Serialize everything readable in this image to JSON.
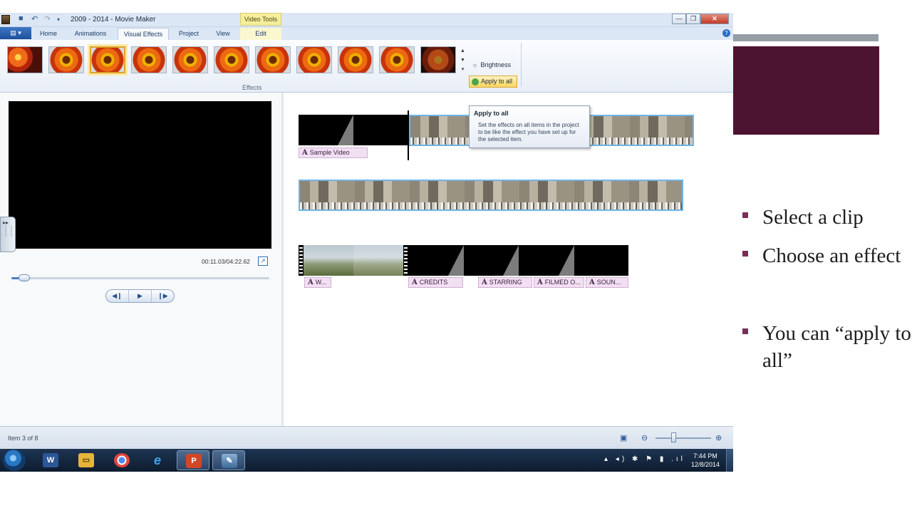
{
  "window": {
    "title": "2009 - 2014 - Movie Maker",
    "contextual_tab_group": "Video Tools",
    "buttons": [
      "—",
      "❐",
      "✕"
    ]
  },
  "tabs": [
    "Home",
    "Animations",
    "Visual Effects",
    "Project",
    "View",
    "Edit"
  ],
  "ribbon": {
    "effects_group_label": "Effects",
    "brightness_label": "Brightness",
    "apply_all_label": "Apply to all"
  },
  "tooltip": {
    "title": "Apply to all",
    "body": "Set the effects on all items in the project to be like the effect you have set up for the selected item."
  },
  "preview": {
    "timecode": "00:11.03/04:22.62",
    "seek_position": 0.05
  },
  "storyboard": {
    "captions_row1": [
      "Sample Video"
    ],
    "captions_row3": [
      "W...",
      "CREDITS",
      "STARRING",
      "FILMED O...",
      "SOUN..."
    ]
  },
  "status": {
    "item_text": "Item 3 of 8"
  },
  "taskbar": {
    "time": "7:44 PM",
    "date": "12/8/2014",
    "apps": [
      "word-icon",
      "explorer-icon",
      "chrome-icon",
      "ie-icon",
      "powerpoint-icon",
      "movie-maker-icon"
    ]
  },
  "slide": {
    "bullets": [
      "Select a clip",
      "Choose an effect",
      "You can “apply to all”"
    ],
    "accent_color": "#4d1432",
    "bar_color": "#959da5"
  }
}
